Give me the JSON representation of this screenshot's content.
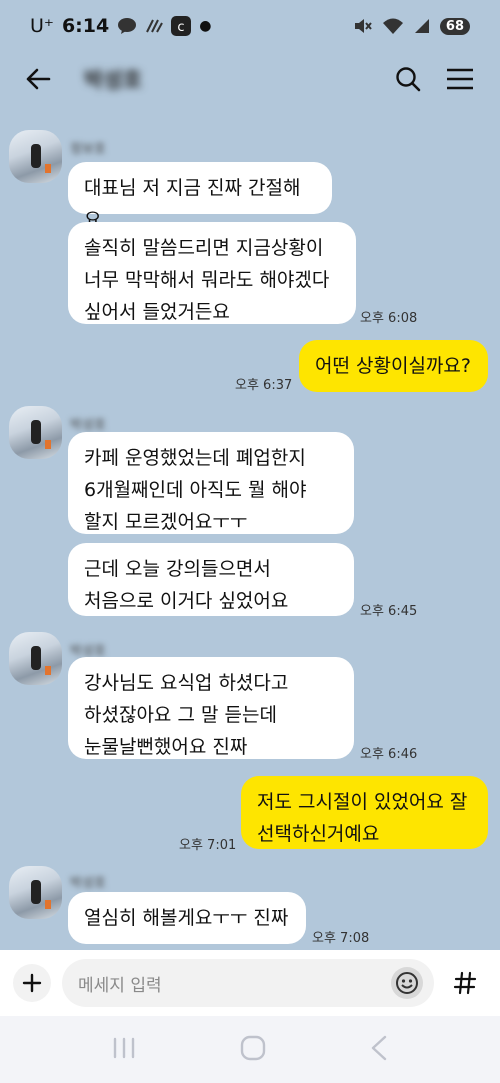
{
  "status_bar": {
    "carrier": "U⁺",
    "time": "6:14",
    "battery": "68"
  },
  "header": {
    "chat_title": "박성호"
  },
  "messages": [
    {
      "sender": "정보호",
      "text": "대표님 저 지금 진짜 간절해요",
      "time": ""
    },
    {
      "text": "솔직히 말씀드리면 지금상황이\n너무 막막해서 뭐라도 해야겠다\n싶어서 들었거든요",
      "time": "오후 6:08"
    },
    {
      "text": "어떤 상황이실까요?",
      "time": "오후 6:37"
    },
    {
      "sender": "박성호",
      "text": "카페 운영했었는데 폐업한지\n6개월째인데 아직도 뭘 해야\n할지 모르겠어요ㅜㅜ",
      "time": ""
    },
    {
      "text": "근데 오늘 강의들으면서\n처음으로 이거다 싶었어요",
      "time": "오후 6:45"
    },
    {
      "sender": "박성호",
      "text": "강사님도 요식업 하셨다고\n하셨잖아요 그 말 듣는데\n눈물날뻔했어요 진짜",
      "time": "오후 6:46"
    },
    {
      "text": "저도 그시절이 있었어요 잘\n선택하신거예요",
      "time": "오후 7:01"
    },
    {
      "sender": "박성호",
      "text": "열심히 해볼게요ㅜㅜ 진짜",
      "time": "오후 7:08"
    }
  ],
  "composer": {
    "placeholder": "메세지 입력"
  },
  "colors": {
    "background": "#b2c7da",
    "my_bubble": "#fee500",
    "their_bubble": "#ffffff"
  }
}
